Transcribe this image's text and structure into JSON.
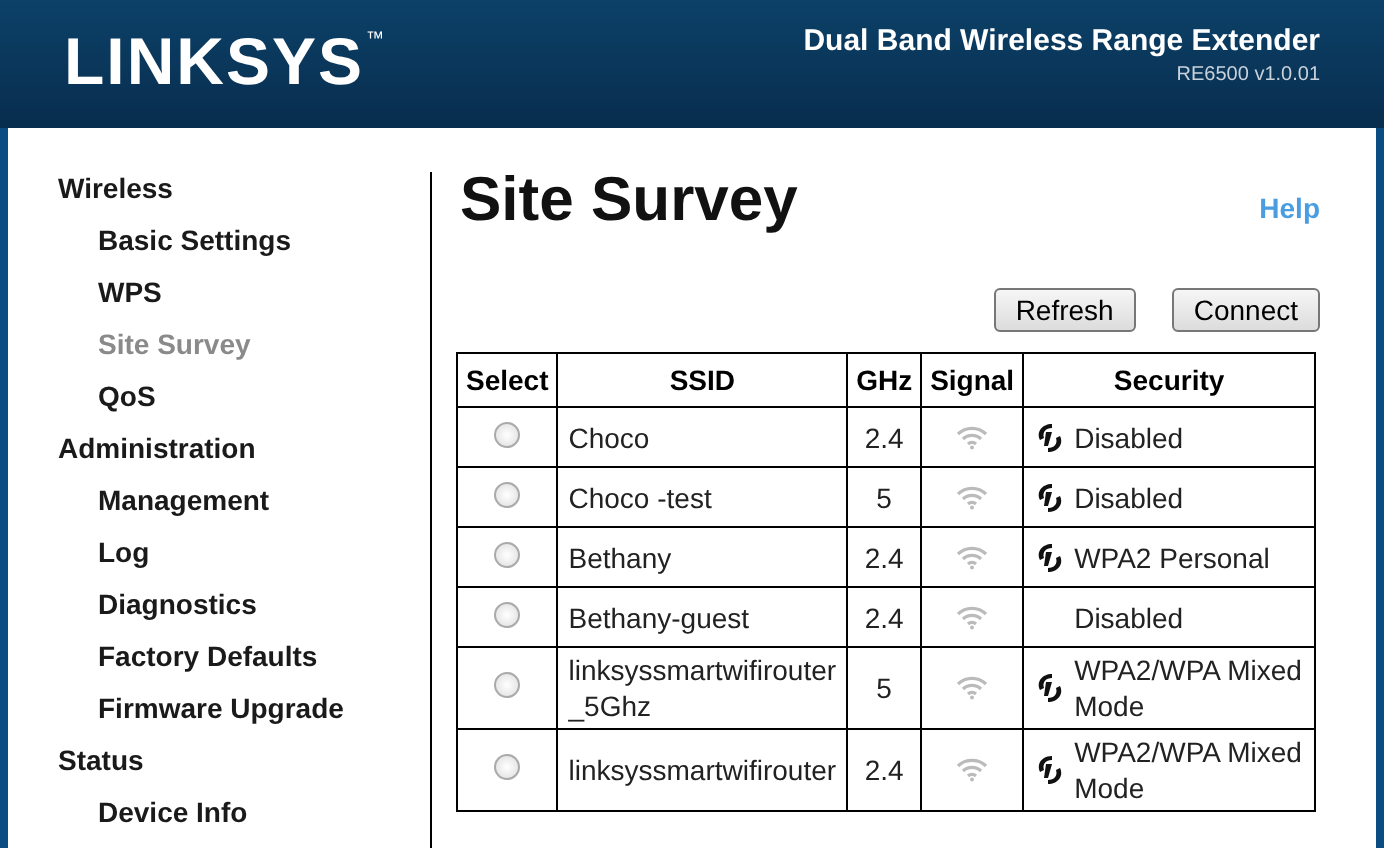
{
  "header": {
    "logo": "LINKSYS",
    "trademark": "™",
    "product": "Dual Band Wireless Range Extender",
    "model": "RE6500 v1.0.01"
  },
  "sidebar": {
    "sections": [
      {
        "label": "Wireless",
        "items": [
          {
            "label": "Basic Settings",
            "selected": false
          },
          {
            "label": "WPS",
            "selected": false
          },
          {
            "label": "Site Survey",
            "selected": true
          },
          {
            "label": "QoS",
            "selected": false
          }
        ]
      },
      {
        "label": "Administration",
        "items": [
          {
            "label": "Management",
            "selected": false
          },
          {
            "label": "Log",
            "selected": false
          },
          {
            "label": "Diagnostics",
            "selected": false
          },
          {
            "label": "Factory Defaults",
            "selected": false
          },
          {
            "label": "Firmware Upgrade",
            "selected": false
          }
        ]
      },
      {
        "label": "Status",
        "items": [
          {
            "label": "Device Info",
            "selected": false
          }
        ]
      }
    ]
  },
  "page": {
    "title": "Site Survey",
    "help": "Help",
    "buttons": [
      "Refresh",
      "Connect"
    ]
  },
  "table": {
    "columns": [
      "Select",
      "SSID",
      "GHz",
      "Signal",
      "Security"
    ],
    "rows": [
      {
        "selected": false,
        "ssid": "Choco",
        "ghz": "2.4",
        "secured": true,
        "security": "Disabled"
      },
      {
        "selected": false,
        "ssid": "Choco -test",
        "ghz": "5",
        "secured": true,
        "security": "Disabled"
      },
      {
        "selected": false,
        "ssid": "Bethany",
        "ghz": "2.4",
        "secured": true,
        "security": "WPA2 Personal"
      },
      {
        "selected": false,
        "ssid": "Bethany-guest",
        "ghz": "2.4",
        "secured": false,
        "security": "Disabled"
      },
      {
        "selected": false,
        "ssid": "linksyssmartwifirouter _5Ghz",
        "ghz": "5",
        "secured": true,
        "security": "WPA2/WPA Mixed Mode"
      },
      {
        "selected": false,
        "ssid": "linksyssmartwifirouter",
        "ghz": "2.4",
        "secured": true,
        "security": "WPA2/WPA Mixed Mode"
      }
    ]
  }
}
